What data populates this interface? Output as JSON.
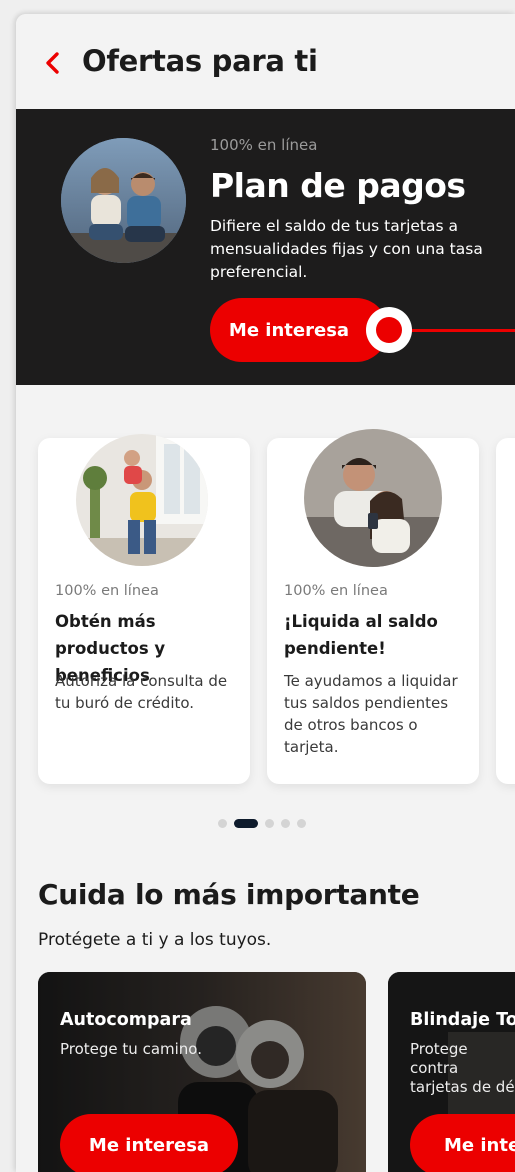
{
  "header": {
    "title": "Ofertas para ti"
  },
  "hero": {
    "kicker": "100% en línea",
    "title": "Plan de pagos",
    "description": "Difiere el saldo de tus tarjetas a mensualidades fijas y con una tasa preferencial.",
    "cta": "Me interesa"
  },
  "offers": [
    {
      "kicker": "100% en línea",
      "title": "Obtén más productos y beneficios",
      "description": "Autoriza la consulta de tu buró de crédito."
    },
    {
      "kicker": "100% en línea",
      "title": "¡Liquida al saldo pendiente!",
      "description": "Te ayudamos a liquidar tus saldos pendientes de otros bancos o tarjeta."
    }
  ],
  "carousel": {
    "total": 5,
    "active": 1
  },
  "protection": {
    "title": "Cuida lo más importante",
    "subtitle": "Protégete a ti y a los tuyos.",
    "cards": [
      {
        "title": "Autocompara",
        "description": "Protege tu camino.",
        "cta": "Me interesa"
      },
      {
        "title": "Blindaje Tot",
        "description": "Protege contra tarjetas de dé",
        "cta": "Me inte"
      }
    ]
  },
  "colors": {
    "brand_red": "#ec0000",
    "hero_bg": "#1d1c1c",
    "active_dot": "#0e1b2c"
  }
}
